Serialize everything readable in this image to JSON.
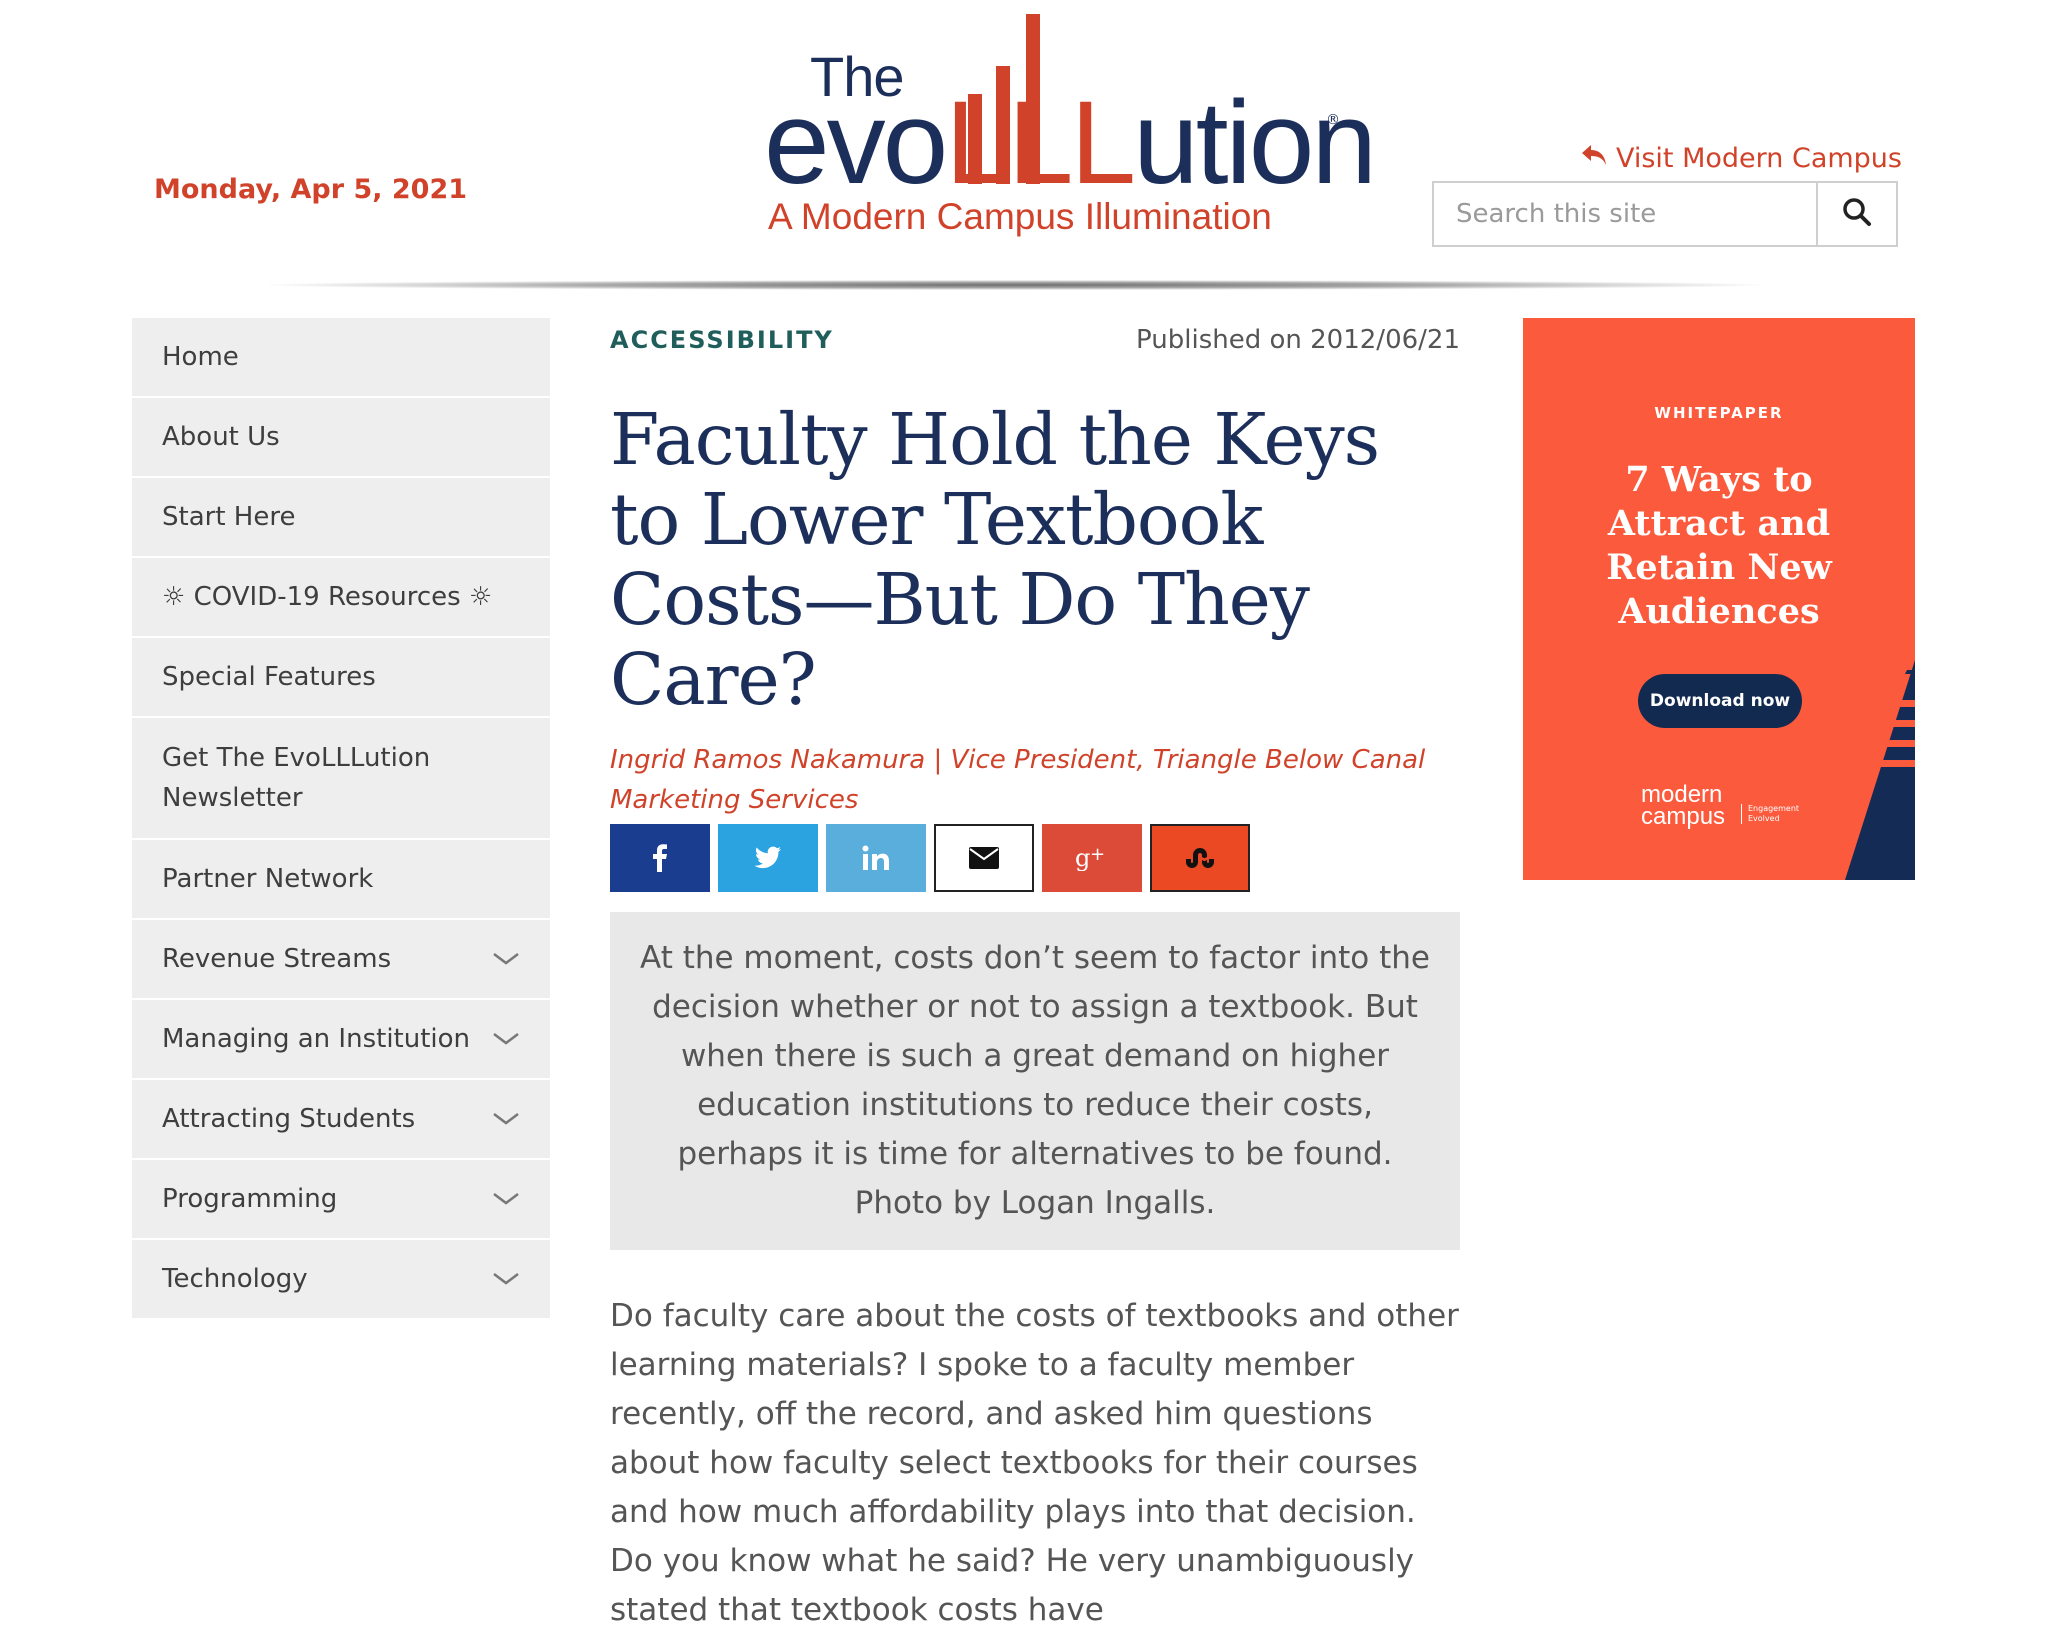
{
  "header": {
    "date": "Monday, Apr 5, 2021",
    "logo": {
      "the": "The",
      "word_start": "evo",
      "word_lll": "LLL",
      "word_end": "ution",
      "registered": "®",
      "tagline": "A Modern Campus Illumination"
    },
    "visit_link": "Visit Modern Campus",
    "search": {
      "placeholder": "Search this site",
      "value": ""
    },
    "colors": {
      "brand_navy": "#1c2e5a",
      "brand_orange": "#d0432a"
    }
  },
  "sidebar": {
    "items": [
      {
        "label": "Home",
        "has_submenu": false
      },
      {
        "label": "About Us",
        "has_submenu": false
      },
      {
        "label": "Start Here",
        "has_submenu": false
      },
      {
        "label": "☼ COVID-19 Resources ☼",
        "has_submenu": false
      },
      {
        "label": "Special Features",
        "has_submenu": false
      },
      {
        "label": "Get The EvoLLLution Newsletter",
        "has_submenu": false
      },
      {
        "label": "Partner Network",
        "has_submenu": false
      },
      {
        "label": "Revenue Streams",
        "has_submenu": true
      },
      {
        "label": "Managing an Institution",
        "has_submenu": true
      },
      {
        "label": "Attracting Students",
        "has_submenu": true
      },
      {
        "label": "Programming",
        "has_submenu": true
      },
      {
        "label": "Technology",
        "has_submenu": true
      }
    ]
  },
  "article": {
    "category": "ACCESSIBILITY",
    "published": "Published on 2012/06/21",
    "title": "Faculty Hold the Keys to Lower Textbook Costs—But Do They Care?",
    "byline": "Ingrid Ramos Nakamura | Vice President, Triangle Below Canal Marketing Services",
    "share_buttons": [
      {
        "name": "facebook",
        "icon": "facebook-icon",
        "color": "#1a3d8f"
      },
      {
        "name": "twitter",
        "icon": "twitter-icon",
        "color": "#2aa3e0"
      },
      {
        "name": "linkedin",
        "icon": "linkedin-icon",
        "color": "#5aaedb"
      },
      {
        "name": "email",
        "icon": "envelope-icon",
        "color": "#ffffff"
      },
      {
        "name": "google-plus",
        "icon": "google-plus-icon",
        "color": "#dc4a38"
      },
      {
        "name": "stumbleupon",
        "icon": "stumbleupon-icon",
        "color": "#eb4924"
      }
    ],
    "caption": "At the moment, costs don’t seem to factor into the decision whether or not to assign a textbook. But when there is such a great demand on higher education institutions to reduce their costs, perhaps it is time for alternatives to be found. Photo by Logan Ingalls.",
    "body": "Do faculty care about the costs of textbooks and other learning materials? I spoke to a faculty member recently, off the record, and asked him questions about how faculty select textbooks for their courses and how much affordability plays into that decision. Do you know what he said? He very unambiguously stated that textbook costs have"
  },
  "ad": {
    "kicker": "WHITEPAPER",
    "title": "7 Ways to Attract and Retain New Audiences",
    "button": "Download now",
    "logo_line1": "modern",
    "logo_line2": "campus",
    "logo_sub_line1": "Engagement",
    "logo_sub_line2": "Evolved",
    "background": "#fc5a3c",
    "button_color": "#122a4f"
  }
}
